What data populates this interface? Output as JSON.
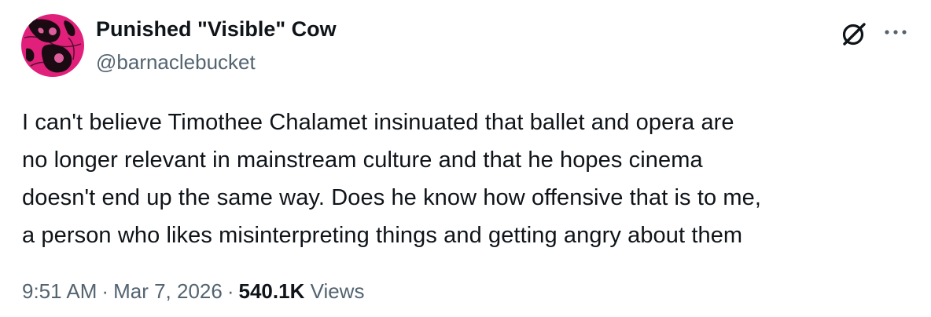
{
  "author": {
    "display_name": "Punished \"Visible\" Cow",
    "handle": "@barnaclebucket"
  },
  "tweet": {
    "text_lines": [
      "I can't believe Timothee Chalamet insinuated that ballet and opera are",
      "no longer relevant in mainstream culture and that he hopes cinema",
      "doesn't end up the same way. Does he know how offensive that is to me,",
      "a person who likes misinterpreting things and getting angry about them"
    ]
  },
  "meta": {
    "time": "9:51 AM",
    "separator": "·",
    "date": "Mar 7, 2026",
    "views_count": "540.1K",
    "views_label": "Views"
  },
  "icons": {
    "grok": "grok-icon",
    "more": "more-dots-icon"
  },
  "colors": {
    "text_primary": "#0f1419",
    "text_secondary": "#536471",
    "avatar_accent": "#e0207a"
  }
}
